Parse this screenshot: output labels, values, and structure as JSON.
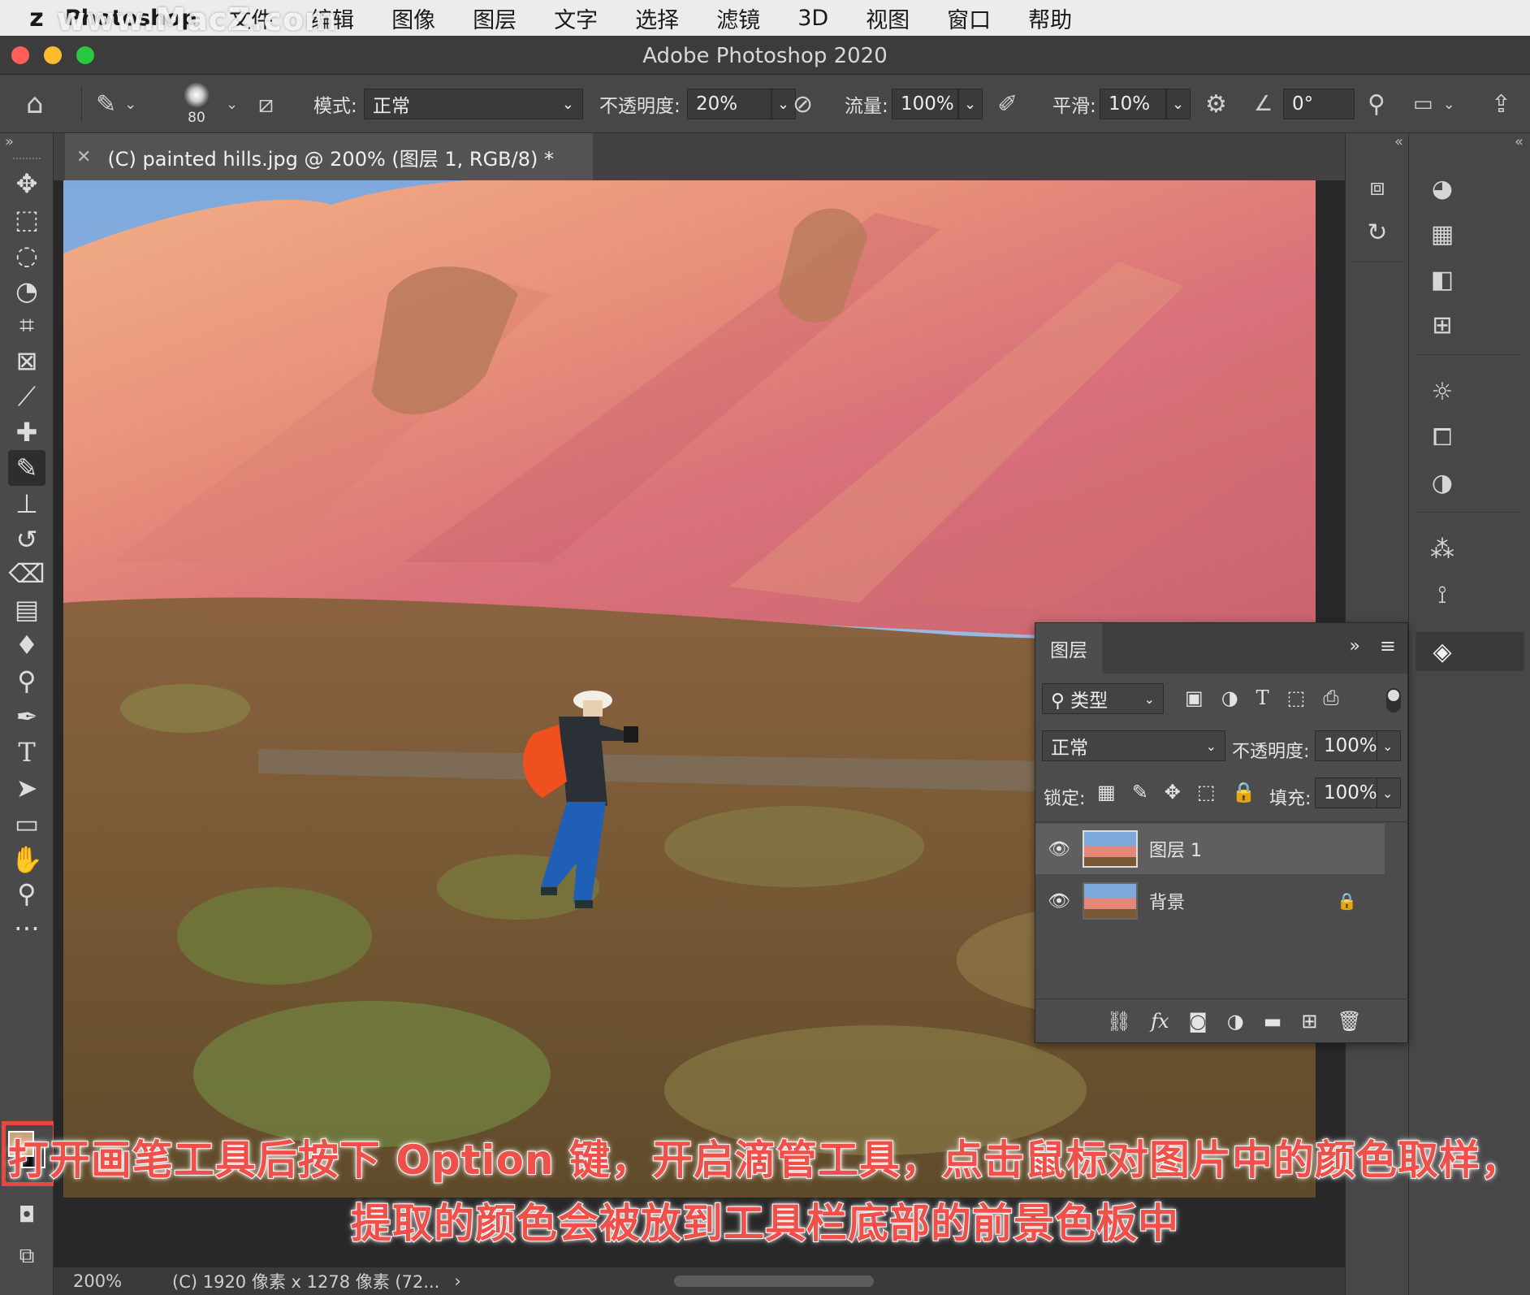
{
  "watermark": "www.MacZ.com",
  "menubar": {
    "app_name": "Photoshop",
    "items": [
      "文件",
      "编辑",
      "图像",
      "图层",
      "文字",
      "选择",
      "滤镜",
      "3D",
      "视图",
      "窗口",
      "帮助"
    ]
  },
  "window": {
    "title": "Adobe Photoshop 2020"
  },
  "options": {
    "brush_size": "80",
    "mode_label": "模式:",
    "mode_value": "正常",
    "opacity_label": "不透明度:",
    "opacity_value": "20%",
    "flow_label": "流量:",
    "flow_value": "100%",
    "smoothing_label": "平滑:",
    "smoothing_value": "10%",
    "angle_value": "0°"
  },
  "document": {
    "tab_title": "(C) painted hills.jpg @ 200% (图层 1, RGB/8) *",
    "zoom": "200%",
    "status_info": "(C) 1920 像素 x 1278 像素 (72..."
  },
  "tools": [
    {
      "name": "move-tool",
      "glyph": "✥"
    },
    {
      "name": "marquee-tool",
      "glyph": "⬚"
    },
    {
      "name": "lasso-tool",
      "glyph": "◌"
    },
    {
      "name": "quick-select-tool",
      "glyph": "⬭"
    },
    {
      "name": "crop-tool",
      "glyph": "⌗"
    },
    {
      "name": "frame-tool",
      "glyph": "⊠"
    },
    {
      "name": "eyedropper-tool",
      "glyph": "⟋"
    },
    {
      "name": "healing-brush-tool",
      "glyph": "✚"
    },
    {
      "name": "brush-tool",
      "glyph": "✎"
    },
    {
      "name": "clone-stamp-tool",
      "glyph": "⊥"
    },
    {
      "name": "history-brush-tool",
      "glyph": "↺"
    },
    {
      "name": "eraser-tool",
      "glyph": "⌫"
    },
    {
      "name": "gradient-tool",
      "glyph": "▤"
    },
    {
      "name": "blur-tool",
      "glyph": "💧"
    },
    {
      "name": "dodge-tool",
      "glyph": "⚲"
    },
    {
      "name": "pen-tool",
      "glyph": "✒"
    },
    {
      "name": "type-tool",
      "glyph": "T"
    },
    {
      "name": "path-select-tool",
      "glyph": "➤"
    },
    {
      "name": "rectangle-tool",
      "glyph": "▭"
    },
    {
      "name": "hand-tool",
      "glyph": "✋"
    },
    {
      "name": "zoom-tool",
      "glyph": "⚲"
    },
    {
      "name": "more-tools",
      "glyph": "…"
    }
  ],
  "colors": {
    "foreground": "#c9a37a",
    "background": "#000000",
    "highlight": "#e8473f"
  },
  "layers_panel": {
    "tab": "图层",
    "filter_label": "类型",
    "blend_mode": "正常",
    "opacity_label": "不透明度:",
    "opacity_value": "100%",
    "lock_label": "锁定:",
    "fill_label": "填充:",
    "fill_value": "100%",
    "layers": [
      {
        "name": "图层 1",
        "selected": true,
        "locked": false
      },
      {
        "name": "背景",
        "selected": false,
        "locked": true
      }
    ]
  },
  "annotation": {
    "line1": "打开画笔工具后按下 Option 键，开启滴管工具，点击鼠标对图片中的颜色取样，",
    "line2": "提取的颜色会被放到工具栏底部的前景色板中"
  }
}
